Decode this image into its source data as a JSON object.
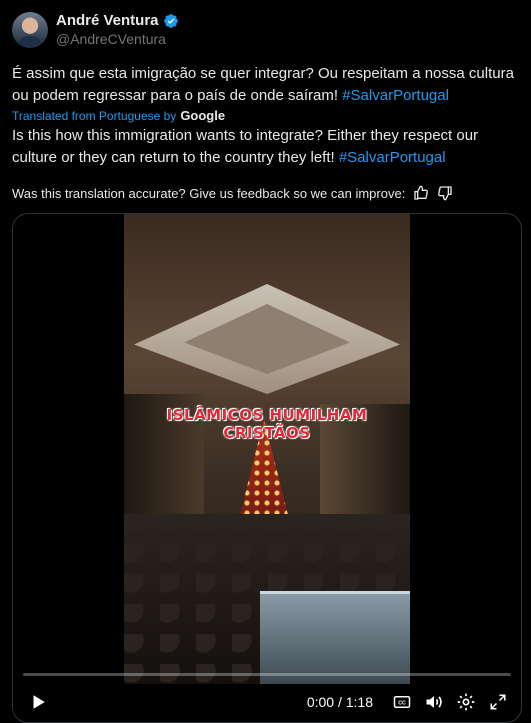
{
  "author": {
    "name": "André Ventura",
    "handle": "@AndreCVentura",
    "verified": true
  },
  "tweet": {
    "original_text": "É assim que esta imigração se quer integrar? Ou respeitam a nossa cultura ou podem regressar para o país de onde saíram! ",
    "original_hashtag": "#SalvarPortugal",
    "translated_from": "Translated from Portuguese by",
    "translator": "Google",
    "translation_text": "Is this how this immigration wants to integrate? Either they respect our culture or they can return to the country they left! ",
    "translation_hashtag": "#SalvarPortugal",
    "feedback_prompt": "Was this translation accurate? Give us feedback so we can improve:"
  },
  "video": {
    "overlay_caption": "ISLÂMICOS HUMILHAM CRISTÃOS",
    "time_display": "0:00 / 1:18",
    "progress_fraction": 0
  },
  "colors": {
    "background": "#000000",
    "text": "#e7e9ea",
    "muted": "#71767b",
    "link": "#1d9bf0",
    "caption": "#e02a3a"
  },
  "icons": {
    "verified": "verified-badge-icon",
    "thumbs_up": "thumbs-up-icon",
    "thumbs_down": "thumbs-down-icon",
    "play": "play-icon",
    "captions": "captions-icon",
    "volume": "volume-icon",
    "settings": "settings-icon",
    "fullscreen": "fullscreen-icon"
  }
}
